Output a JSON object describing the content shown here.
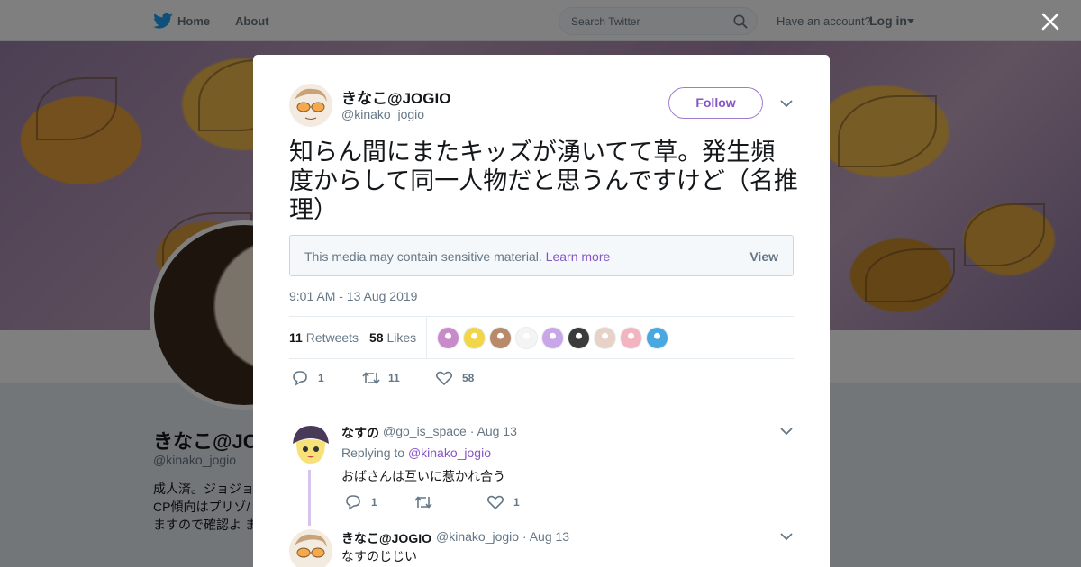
{
  "nav": {
    "home": "Home",
    "about": "About",
    "search_placeholder": "Search Twitter",
    "have_account": "Have an account?",
    "login": "Log in"
  },
  "profile": {
    "name": "きなこ@JO",
    "handle": "@kinako_jogio",
    "bio": "成人済。ジョジョ CP傾向はプリゾ/ みますので確認よ ます"
  },
  "tweet": {
    "author_name": "きなこ@JOGIO",
    "author_handle": "@kinako_jogio",
    "follow_label": "Follow",
    "text": "知らん間にまたキッズが湧いてて草。発生頻度からして同一人物だと思うんですけど（名推理）",
    "sensitive_text": "This media may contain sensitive material.",
    "sensitive_link": "Learn more",
    "sensitive_view": "View",
    "timestamp": "9:01 AM - 13 Aug 2019",
    "retweets_count": "11",
    "retweets_label": "Retweets",
    "likes_count": "58",
    "likes_label": "Likes",
    "actions": {
      "replies": "1",
      "retweets": "11",
      "likes": "58"
    },
    "likers": [
      {
        "color": "#c88ac8"
      },
      {
        "color": "#f2d64a"
      },
      {
        "color": "#b98a6a"
      },
      {
        "color": "#f4f4f4"
      },
      {
        "color": "#c9a6e8"
      },
      {
        "color": "#3b3b3b"
      },
      {
        "color": "#e8d2c8"
      },
      {
        "color": "#f2b5c0"
      },
      {
        "color": "#4aa8e0"
      }
    ]
  },
  "replies": [
    {
      "name": "なすの",
      "handle": "@go_is_space",
      "time": "· Aug 13",
      "replying_prefix": "Replying to",
      "replying_to": "@kinako_jogio",
      "text": "おばさんは互いに惹かれ合う",
      "actions": {
        "replies": "1",
        "retweets": "",
        "likes": "1"
      }
    },
    {
      "name": "きなこ@JOGIO",
      "handle": "@kinako_jogio",
      "time": "· Aug 13",
      "text": "なすのじじい"
    }
  ],
  "colors": {
    "accent": "#8555c7",
    "text_secondary": "#657786",
    "twitter_blue": "#1da1f2"
  }
}
